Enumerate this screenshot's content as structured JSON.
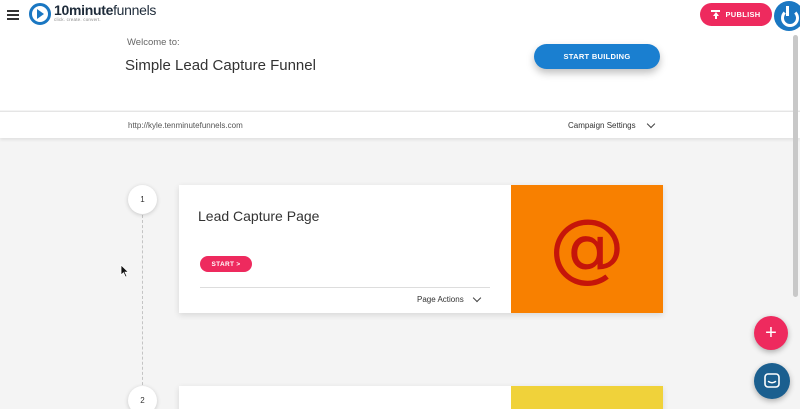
{
  "header": {
    "menu_icon": "hamburger-menu-icon",
    "logo": {
      "main_bold": "10minute",
      "main_light": "funnels",
      "tagline": "click. create. convert."
    },
    "publish_label": "PUBLISH",
    "publish_icon": "upload-icon",
    "power_icon": "power-icon"
  },
  "hero": {
    "welcome_label": "Welcome to:",
    "funnel_name": "Simple Lead Capture Funnel",
    "start_building_label": "START BUILDING"
  },
  "url_bar": {
    "url": "http://kyle.tenminutefunnels.com",
    "campaign_settings_label": "Campaign Settings"
  },
  "steps": [
    {
      "number": "1",
      "page_title": "Lead Capture Page",
      "start_label": "START >",
      "page_actions_label": "Page Actions",
      "thumbnail_glyph": "@",
      "thumbnail_color": "#f88000"
    },
    {
      "number": "2",
      "thumbnail_color": "#f0d23a"
    }
  ],
  "fab": {
    "add_label": "+",
    "chat_icon": "chat-icon"
  },
  "colors": {
    "accent_pink": "#ee2a5e",
    "brand_blue": "#1a7fd0",
    "chat_blue": "#1b5f8f"
  }
}
